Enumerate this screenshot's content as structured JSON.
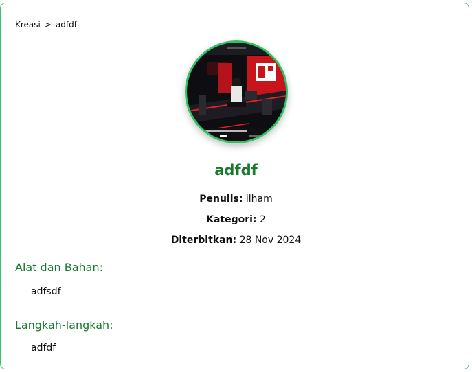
{
  "breadcrumb": {
    "parent": "Kreasi",
    "separator": ">",
    "current": "adfdf"
  },
  "article": {
    "title": "adfdf",
    "image_alt": "cover image",
    "author_label": "Penulis:",
    "author": "ilham",
    "category_label": "Kategori:",
    "category": "2",
    "published_label": "Diterbitkan:",
    "published": "28 Nov 2024"
  },
  "sections": {
    "materials_title": "Alat dan Bahan:",
    "materials_body": "adfsdf",
    "steps_title": "Langkah-langkah:",
    "steps_body": "adfdf"
  },
  "colors": {
    "accent_green": "#177a2f",
    "border_green": "#3ec46d"
  }
}
